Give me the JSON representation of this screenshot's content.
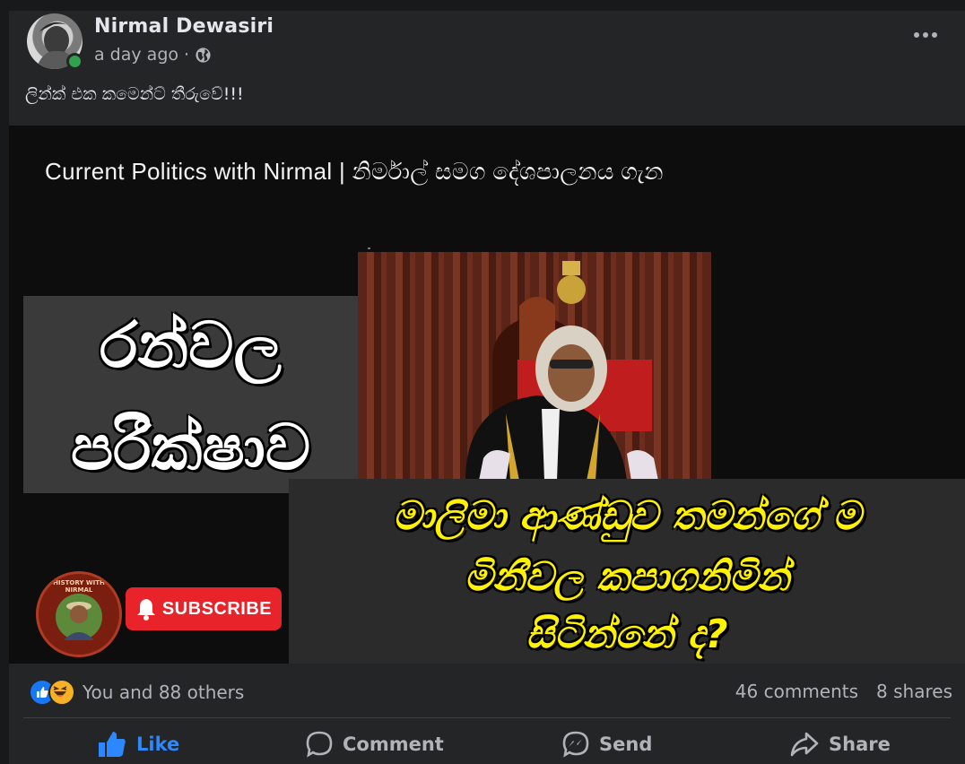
{
  "post": {
    "author": "Nirmal Dewasiri",
    "time": "a day ago",
    "separator": "·",
    "caption": "ලින්ක් එක කමෙන්ට් තීරුවේ!!!"
  },
  "video": {
    "title": "Current Politics with Nirmal | නිර්මාල් සමග දේශපාලනය ගැන",
    "headline_line1": "රන්වල",
    "headline_line2": "පරීක්ෂාව",
    "question_line1": "මාලිමා ආණ්ඩුව තමන්ගේ ම",
    "question_line2": "මිනීවල කපාගනිමින්",
    "question_line3": "සිටින්නේ ද?",
    "channel_logo_text": "HISTORY WITH NIRMAL",
    "subscribe_label": "SUBSCRIBE"
  },
  "stats": {
    "reactions_text": "You and 88 others",
    "comments": "46 comments",
    "shares": "8 shares"
  },
  "actions": {
    "like": "Like",
    "comment": "Comment",
    "send": "Send",
    "share": "Share"
  },
  "colors": {
    "background": "#242526",
    "like_blue": "#2d88ff",
    "subscribe_red": "#e8232a",
    "headline_yellow": "#fff200",
    "online_green": "#31a24c"
  },
  "icons": [
    "globe-icon",
    "more-icon",
    "like-reaction-icon",
    "haha-reaction-icon",
    "bell-icon",
    "like-icon",
    "comment-icon",
    "send-icon",
    "share-icon"
  ]
}
